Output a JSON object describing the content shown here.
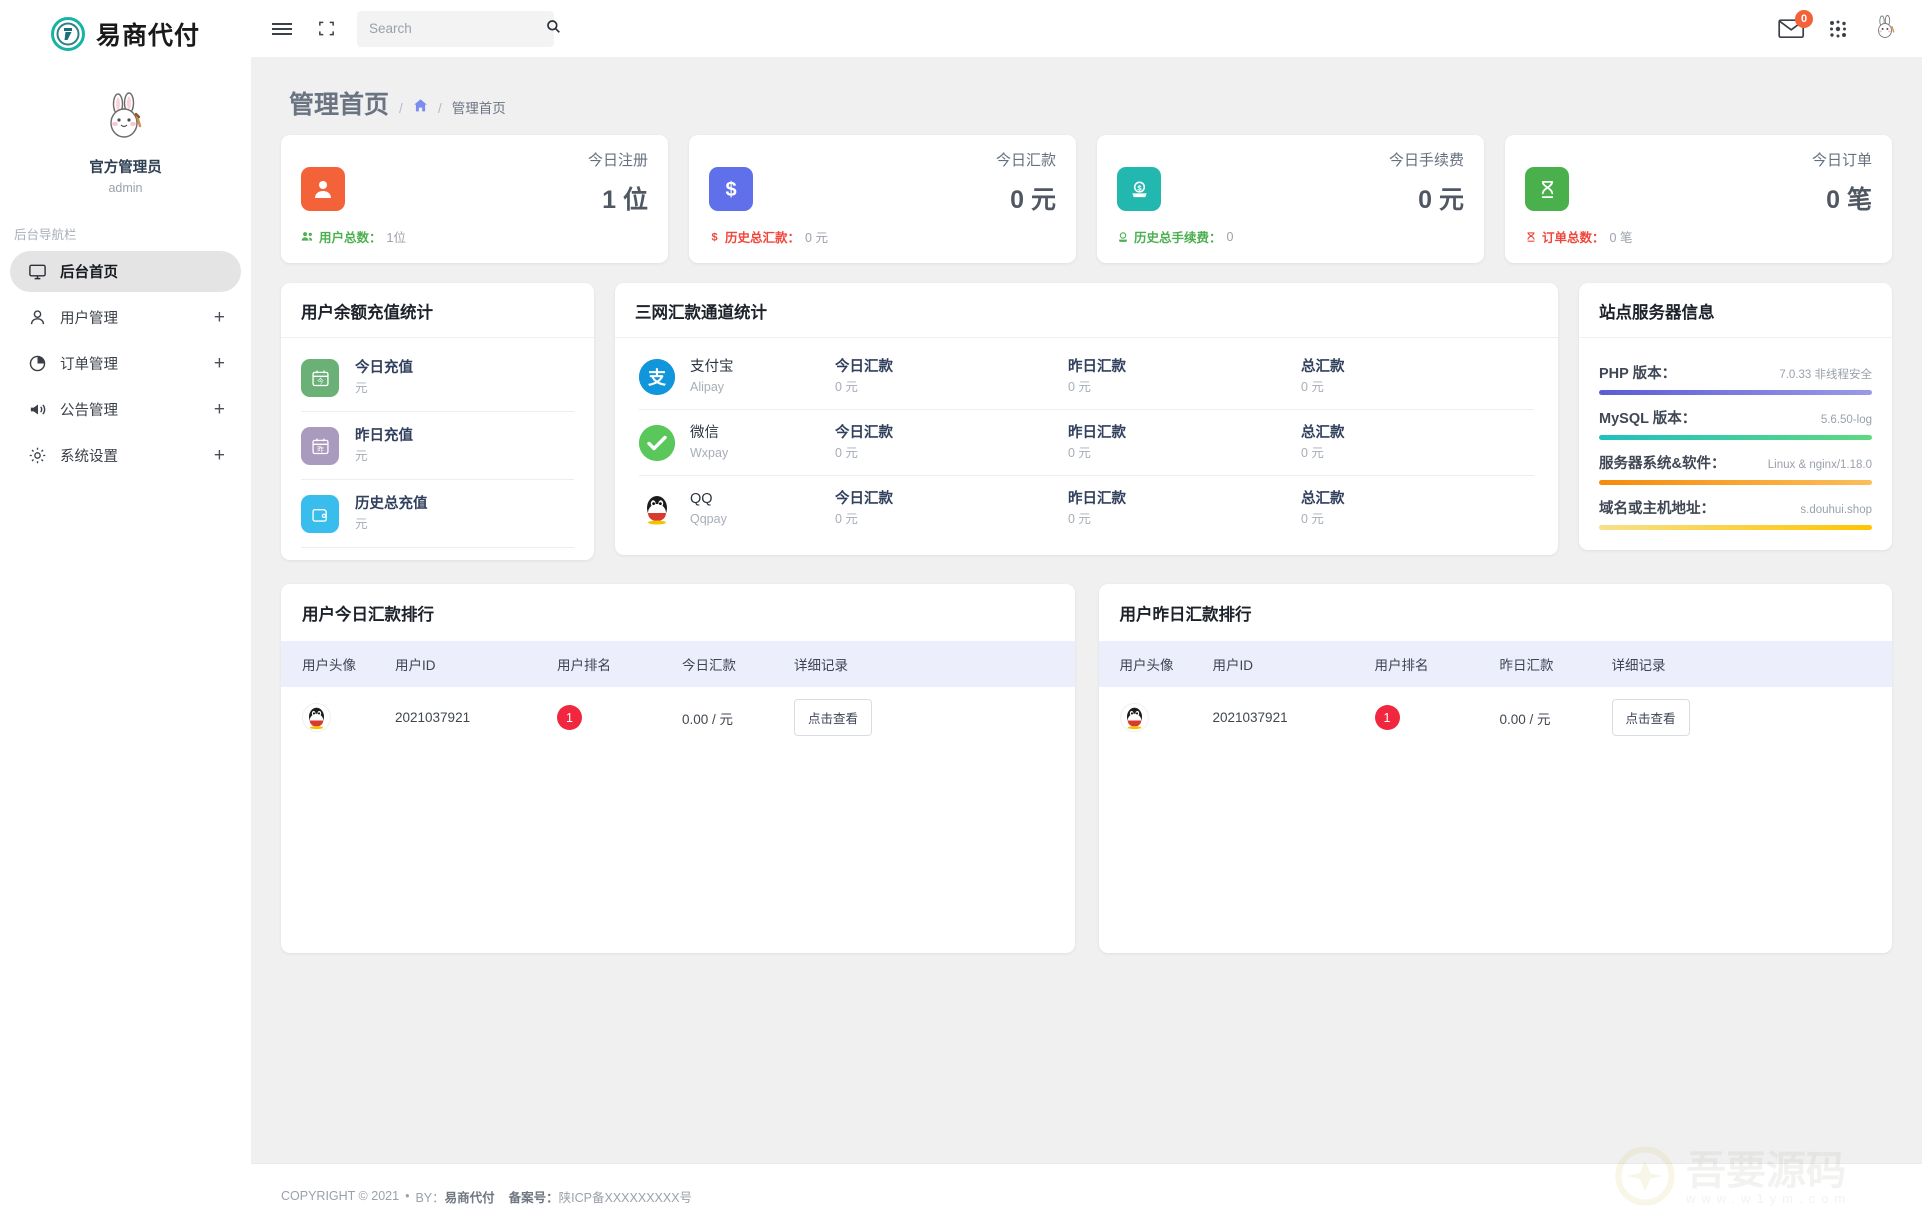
{
  "brand": {
    "name": "易商代付",
    "logo_icon": "brand-logo-icon"
  },
  "profile": {
    "name": "官方管理员",
    "username": "admin",
    "avatar_icon": "rabbit-avatar-icon"
  },
  "sidebar": {
    "nav_title": "后台导航栏",
    "items": [
      {
        "label": "后台首页",
        "icon": "monitor-icon",
        "active": true,
        "expand": ""
      },
      {
        "label": "用户管理",
        "icon": "user-icon",
        "active": false,
        "expand": "+"
      },
      {
        "label": "订单管理",
        "icon": "pie-chart-icon",
        "active": false,
        "expand": "+"
      },
      {
        "label": "公告管理",
        "icon": "megaphone-icon",
        "active": false,
        "expand": "+"
      },
      {
        "label": "系统设置",
        "icon": "gear-icon",
        "active": false,
        "expand": "+"
      }
    ]
  },
  "topbar": {
    "menu_icon": "hamburger-icon",
    "fullscreen_icon": "fullscreen-icon",
    "search": {
      "placeholder": "Search",
      "value": "",
      "icon": "search-icon"
    },
    "mail": {
      "icon": "mail-icon",
      "badge": "0"
    },
    "apps_icon": "apps-grid-icon",
    "avatar_icon": "rabbit-avatar-icon"
  },
  "page": {
    "title": "管理首页",
    "breadcrumb": {
      "sep": "/",
      "home_icon": "home-icon",
      "current": "管理首页"
    }
  },
  "stats": [
    {
      "label": "今日注册",
      "value": "1 位",
      "icon": "user-solid-icon",
      "color": "#f4623a",
      "foot_icon": "users-icon",
      "foot_icon_color": "#4caf50",
      "foot_label": "用户总数：",
      "foot_value": "1位",
      "foot_color": "#4caf50"
    },
    {
      "label": "今日汇款",
      "value": "0 元",
      "icon": "dollar-icon",
      "color": "#6070ea",
      "foot_icon": "dollar-sign-icon",
      "foot_icon_color": "#f4453a",
      "foot_label": "历史总汇款：",
      "foot_value": "0 元",
      "foot_color": "#f4453a"
    },
    {
      "label": "今日手续费",
      "value": "0 元",
      "icon": "coin-deposit-icon",
      "color": "#22b8b0",
      "foot_icon": "coin-icon",
      "foot_icon_color": "#4caf50",
      "foot_label": "历史总手续费：",
      "foot_value": "0",
      "foot_color": "#4caf50"
    },
    {
      "label": "今日订单",
      "value": "0 笔",
      "icon": "dna-icon",
      "color": "#49b04b",
      "foot_icon": "dna-small-icon",
      "foot_icon_color": "#f4453a",
      "foot_label": "订单总数：",
      "foot_value": "0 笔",
      "foot_color": "#f4453a"
    }
  ],
  "recharge": {
    "title": "用户余额充值统计",
    "items": [
      {
        "title": "今日充值",
        "unit": "元",
        "icon": "calendar-today-icon",
        "color": "#6ab077"
      },
      {
        "title": "昨日充值",
        "unit": "元",
        "icon": "calendar-yesterday-icon",
        "color": "#a99bbd"
      },
      {
        "title": "历史总充值",
        "unit": "元",
        "icon": "wallet-icon",
        "color": "#38bdec"
      }
    ]
  },
  "channels": {
    "title": "三网汇款通道统计",
    "rows": [
      {
        "name": "支付宝",
        "sub": "Alipay",
        "icon": "alipay-icon",
        "color": "#1296db",
        "cols": [
          {
            "t": "今日汇款",
            "v": "0 元"
          },
          {
            "t": "昨日汇款",
            "v": "0 元"
          },
          {
            "t": "总汇款",
            "v": "0 元"
          }
        ]
      },
      {
        "name": "微信",
        "sub": "Wxpay",
        "icon": "wechat-icon",
        "color": "#5ac75a",
        "cols": [
          {
            "t": "今日汇款",
            "v": "0 元"
          },
          {
            "t": "昨日汇款",
            "v": "0 元"
          },
          {
            "t": "总汇款",
            "v": "0 元"
          }
        ]
      },
      {
        "name": "QQ",
        "sub": "Qqpay",
        "icon": "qq-penguin-icon",
        "color": "#ffffff",
        "cols": [
          {
            "t": "今日汇款",
            "v": "0 元"
          },
          {
            "t": "昨日汇款",
            "v": "0 元"
          },
          {
            "t": "总汇款",
            "v": "0 元"
          }
        ]
      }
    ]
  },
  "server": {
    "title": "站点服务器信息",
    "items": [
      {
        "key": "PHP 版本：",
        "value": "7.0.33 非线程安全",
        "bar_from": "#5b5bd6",
        "bar_to": "#9a9ae8"
      },
      {
        "key": "MySQL 版本：",
        "value": "5.6.50-log",
        "bar_from": "#1fc0c0",
        "bar_to": "#5fd97f"
      },
      {
        "key": "服务器系统&软件：",
        "value": "Linux & nginx/1.18.0",
        "bar_from": "#f58b0a",
        "bar_to": "#fbbe5a"
      },
      {
        "key": "域名或主机地址：",
        "value": "s.douhui.shop",
        "bar_from": "#f7e08a",
        "bar_to": "#ffc400"
      }
    ]
  },
  "rank_today": {
    "title": "用户今日汇款排行",
    "columns": [
      "用户头像",
      "用户ID",
      "用户排名",
      "今日汇款",
      "详细记录"
    ],
    "rows": [
      {
        "avatar_icon": "qq-penguin-icon",
        "user_id": "2021037921",
        "rank": "1",
        "amount": "0.00 / 元",
        "action": "点击查看"
      }
    ]
  },
  "rank_yesterday": {
    "title": "用户昨日汇款排行",
    "columns": [
      "用户头像",
      "用户ID",
      "用户排名",
      "昨日汇款",
      "详细记录"
    ],
    "rows": [
      {
        "avatar_icon": "qq-penguin-icon",
        "user_id": "2021037921",
        "rank": "1",
        "amount": "0.00 / 元",
        "action": "点击查看"
      }
    ]
  },
  "footer": {
    "copyright": "COPYRIGHT © 2021",
    "dot": "•",
    "by_label": "BY：",
    "by_name": "易商代付",
    "icp_label": "备案号：",
    "icp_value": "陕ICP备XXXXXXXXX号"
  },
  "watermark": {
    "text": "吾要源码",
    "url": "www.w1ym.com"
  },
  "colors": {
    "accent": "#6070ea",
    "danger": "#f0273e",
    "orange": "#f4623a",
    "green": "#49b04b",
    "teal": "#22b8b0"
  }
}
